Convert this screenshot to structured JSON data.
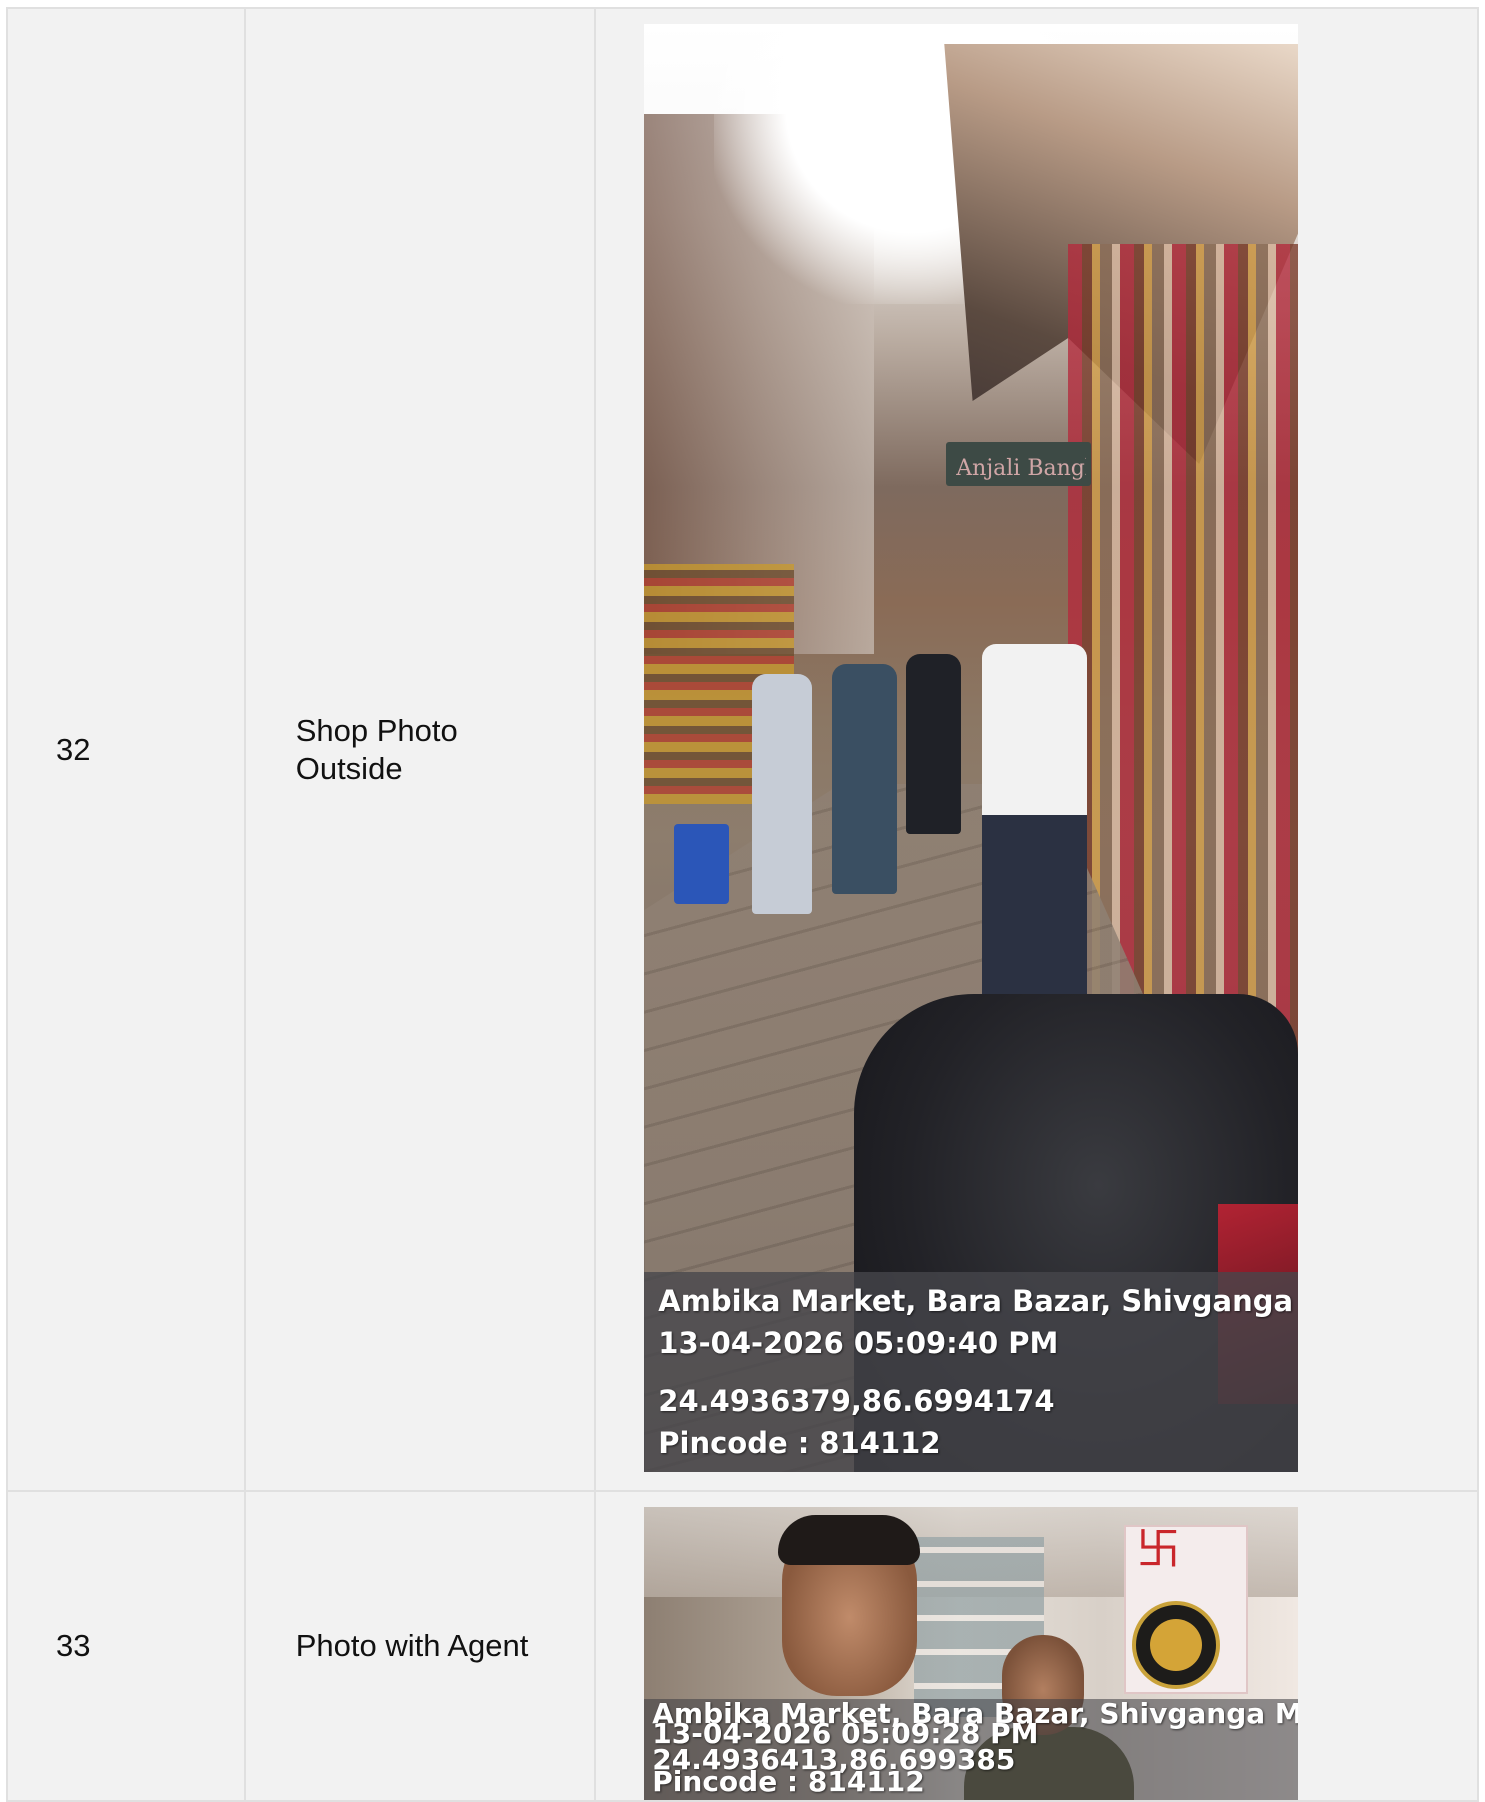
{
  "rows": [
    {
      "number": "32",
      "label": "Shop Photo Outside",
      "photo": {
        "sign_text": "Anjali Bangles",
        "overlay": {
          "location": "Ambika Market, Bara Bazar, Shivganga Muha",
          "datetime": "13-04-2026 05:09:40 PM",
          "coords": "24.4936379,86.6994174",
          "pincode": "Pincode : 814112"
        }
      }
    },
    {
      "number": "33",
      "label": "Photo with Agent",
      "photo": {
        "overlay": {
          "location": "Ambika Market, Bara Bazar, Shivganga Muha",
          "datetime": "13-04-2026 05:09:28 PM",
          "coords": "24.4936413,86.699385",
          "pincode": "Pincode : 814112"
        }
      }
    }
  ]
}
